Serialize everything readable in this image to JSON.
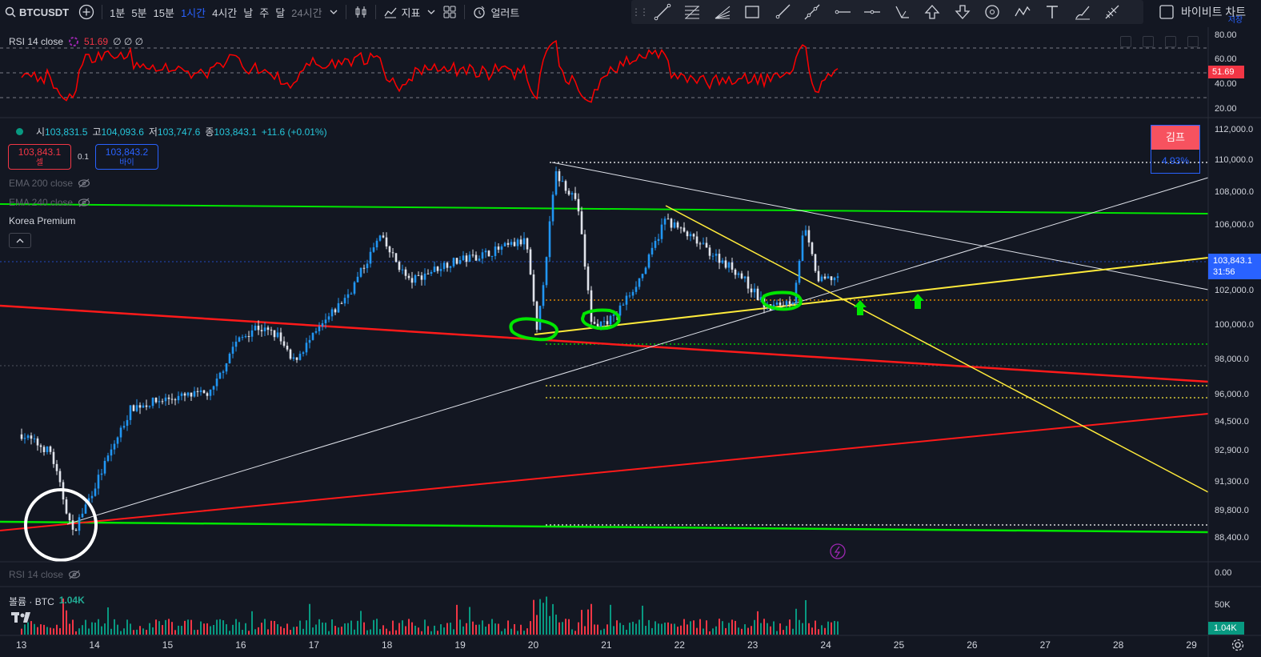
{
  "toolbar": {
    "symbol": "BTCUSDT",
    "intervals": [
      "1분",
      "5분",
      "15분",
      "1시간",
      "4시간",
      "날",
      "주",
      "달",
      "24시간"
    ],
    "active_interval": "1시간",
    "indicators_label": "지표",
    "alert_label": "얼러트",
    "layout_name": "바이비트 차트",
    "save_label": "저장"
  },
  "rsi_pane": {
    "legend": "RSI 14 close",
    "value": "51.69",
    "extras": "∅ ∅ ∅",
    "axis_labels": [
      "80.00",
      "60.00",
      "40.00",
      "20.00"
    ],
    "current_badge": "51.69"
  },
  "main_pane": {
    "ohlc": {
      "open_label": "시",
      "open": "103,831.5",
      "high_label": "고",
      "high": "104,093.6",
      "low_label": "저",
      "low": "103,747.6",
      "close_label": "종",
      "close": "103,843.1",
      "change": "+11.6 (+0.01%)"
    },
    "sell": {
      "price": "103,843.1",
      "label": "셀"
    },
    "buy": {
      "price": "103,843.2",
      "label": "바이"
    },
    "spread": "0.1",
    "ema1": "EMA 200 close",
    "ema2": "EMA 240 close",
    "korea_premium": "Korea Premium",
    "kimp": {
      "label": "김프",
      "value": "4.93%"
    },
    "axis_labels": [
      "112,000.0",
      "110,000.0",
      "108,000.0",
      "106,000.0",
      "102,000.0",
      "100,000.0",
      "98,000.0",
      "96,000.0",
      "94,500.0",
      "92,900.0",
      "91,300.0",
      "89,800.0",
      "88,400.0"
    ],
    "current_price": "103,843.1",
    "countdown": "31:56"
  },
  "rsi2_pane": {
    "legend": "RSI 14 close",
    "axis_label": "0.00"
  },
  "volume_pane": {
    "legend": "볼륨 · BTC",
    "value": "1.04K",
    "axis_label": "50K",
    "current_badge": "1.04K"
  },
  "time_axis": [
    "13",
    "14",
    "15",
    "16",
    "17",
    "18",
    "19",
    "20",
    "21",
    "22",
    "23",
    "24",
    "25",
    "26",
    "27",
    "28",
    "29"
  ],
  "colors": {
    "up": "#2196f3",
    "down": "#e0e3eb",
    "rsi_line": "#ff0000",
    "green_line": "#00e600",
    "red_line": "#ff1a1a",
    "yellow_line": "#ffeb3b",
    "accent": "#2962ff"
  },
  "chart_data": {
    "type": "candlestick",
    "x_axis": "date (hourly candles)",
    "price_range": [
      88000,
      112500
    ],
    "key_prices": {
      "open": 103831.5,
      "high": 104093.6,
      "low": 103747.6,
      "close": 103843.1
    },
    "swing_points": [
      {
        "day": 13.0,
        "price": 95000
      },
      {
        "day": 13.4,
        "price": 94000
      },
      {
        "day": 13.7,
        "price": 89500
      },
      {
        "day": 14.1,
        "price": 93000
      },
      {
        "day": 14.5,
        "price": 96500
      },
      {
        "day": 15.0,
        "price": 97000
      },
      {
        "day": 15.6,
        "price": 97300
      },
      {
        "day": 15.9,
        "price": 100000
      },
      {
        "day": 16.2,
        "price": 101000
      },
      {
        "day": 16.5,
        "price": 100500
      },
      {
        "day": 16.7,
        "price": 99000
      },
      {
        "day": 17.1,
        "price": 101000
      },
      {
        "day": 17.5,
        "price": 103000
      },
      {
        "day": 17.9,
        "price": 106000
      },
      {
        "day": 18.3,
        "price": 103500
      },
      {
        "day": 18.8,
        "price": 104500
      },
      {
        "day": 19.3,
        "price": 105000
      },
      {
        "day": 19.9,
        "price": 105800
      },
      {
        "day": 20.05,
        "price": 100500
      },
      {
        "day": 20.3,
        "price": 109500
      },
      {
        "day": 20.6,
        "price": 108000
      },
      {
        "day": 20.8,
        "price": 101000
      },
      {
        "day": 21.1,
        "price": 101500
      },
      {
        "day": 21.5,
        "price": 104000
      },
      {
        "day": 21.8,
        "price": 107000
      },
      {
        "day": 22.3,
        "price": 105500
      },
      {
        "day": 22.8,
        "price": 104000
      },
      {
        "day": 23.2,
        "price": 102000
      },
      {
        "day": 23.55,
        "price": 102500
      },
      {
        "day": 23.7,
        "price": 106500
      },
      {
        "day": 23.9,
        "price": 103500
      },
      {
        "day": 24.2,
        "price": 103843
      }
    ]
  }
}
